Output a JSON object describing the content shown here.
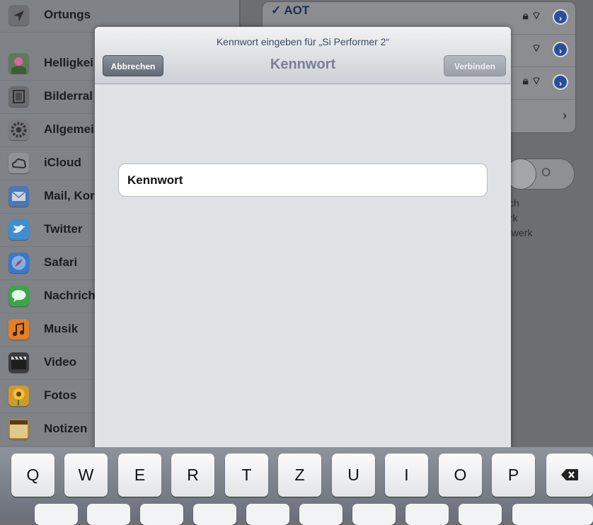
{
  "sidebar": {
    "items": [
      {
        "label": "Ortungs",
        "icon": "location-icon",
        "color": "#6d6f73"
      },
      {
        "label": "Helligkei",
        "icon": "brightness-flower-icon",
        "color": "#5f7a5a"
      },
      {
        "label": "Bilderral",
        "icon": "picture-frame-icon",
        "color": "#6b6c6e"
      },
      {
        "label": "Allgemei",
        "icon": "gear-icon",
        "color": "#7a7c80"
      },
      {
        "label": "iCloud",
        "icon": "cloud-icon",
        "color": "#8f9296"
      },
      {
        "label": "Mail, Kor",
        "icon": "mail-icon",
        "color": "#4c76b5"
      },
      {
        "label": "Twitter",
        "icon": "twitter-bird-icon",
        "color": "#3d8fd0"
      },
      {
        "label": "Safari",
        "icon": "safari-compass-icon",
        "color": "#3b78c7"
      },
      {
        "label": "Nachrich",
        "icon": "messages-bubble-icon",
        "color": "#3aa64a"
      },
      {
        "label": "Musik",
        "icon": "music-note-icon",
        "color": "#e57f21"
      },
      {
        "label": "Video",
        "icon": "video-clapper-icon",
        "color": "#3a3c3f"
      },
      {
        "label": "Fotos",
        "icon": "sunflower-icon",
        "color": "#cf9a2a"
      },
      {
        "label": "Notizen",
        "icon": "notes-pad-icon",
        "color": "#b0863b"
      }
    ]
  },
  "detail": {
    "networks": [
      {
        "name": "✓ AOT"
      },
      {
        "name": ""
      },
      {
        "name": ""
      }
    ],
    "description_lines": [
      "sch",
      "erk",
      "tzwerk"
    ],
    "switch_label": "O"
  },
  "modal": {
    "prompt": "Kennwort eingeben für „Si Performer 2“",
    "title": "Kennwort",
    "cancel_label": "Abbrechen",
    "connect_label": "Verbinden",
    "password_label": "Kennwort"
  },
  "keyboard": {
    "row1": [
      "Q",
      "W",
      "E",
      "R",
      "T",
      "Z",
      "U",
      "I",
      "O",
      "P"
    ],
    "delete_icon": "backspace-icon"
  }
}
